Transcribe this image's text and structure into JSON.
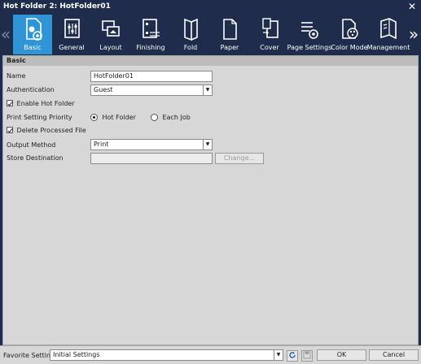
{
  "window": {
    "title": "Hot Folder 2: HotFolder01",
    "close_glyph": "✕"
  },
  "toolbar": {
    "prev_glyph": "«",
    "next_glyph": "»",
    "tabs": [
      {
        "label": "Basic",
        "icon": "gear-document-icon"
      },
      {
        "label": "General",
        "icon": "document-settings-icon"
      },
      {
        "label": "Layout",
        "icon": "layout-pages-icon"
      },
      {
        "label": "Finishing",
        "icon": "finishing-icon"
      },
      {
        "label": "Fold",
        "icon": "fold-icon"
      },
      {
        "label": "Paper",
        "icon": "paper-icon"
      },
      {
        "label": "Cover",
        "icon": "cover-icon"
      },
      {
        "label": "Page Settings",
        "icon": "page-settings-icon"
      },
      {
        "label": "Color Mode",
        "icon": "color-palette-icon"
      },
      {
        "label": "Management",
        "icon": "book-management-icon"
      }
    ],
    "active_tab": "Basic"
  },
  "basic": {
    "section_title": "Basic",
    "name_label": "Name",
    "name_value": "HotFolder01",
    "auth_label": "Authentication",
    "auth_value": "Guest",
    "enable_hot_folder": "Enable Hot Folder",
    "print_priority_label": "Print Setting Priority",
    "priority_hot_folder": "Hot Folder",
    "priority_each_job": "Each Job",
    "delete_processed": "Delete Processed File",
    "output_method_label": "Output Method",
    "output_method_value": "Print",
    "store_dest_label": "Store Destination",
    "store_dest_value": "",
    "change_button": "Change..."
  },
  "footer": {
    "favorite_label": "Favorite Setting",
    "favorite_value": "Initial Settings",
    "ok": "OK",
    "cancel": "Cancel"
  },
  "colors": {
    "titlebar": "#1f2c4b",
    "active_tab": "#2f95d6",
    "panel": "#d7d7d7"
  }
}
